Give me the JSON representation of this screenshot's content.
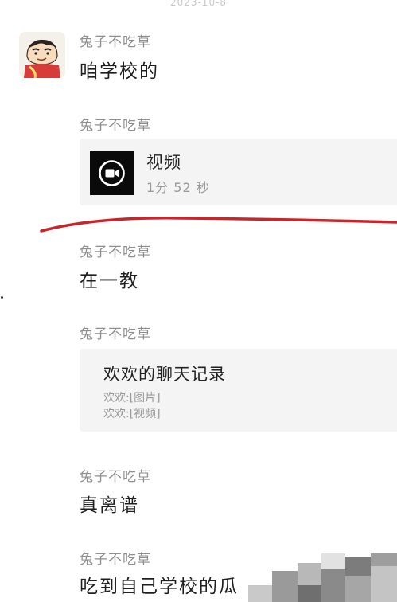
{
  "timestamp": "2023-10-8",
  "messages": [
    {
      "sender": "兔子不吃草",
      "text": "咱学校的"
    },
    {
      "sender": "兔子不吃草",
      "video": {
        "label": "视频",
        "duration": "1分 52 秒"
      }
    },
    {
      "sender": "兔子不吃草",
      "text": "在一教"
    },
    {
      "sender": "兔子不吃草",
      "chat_record": {
        "title": "欢欢的聊天记录",
        "lines": [
          "欢欢:[图片]",
          "欢欢:[视频]"
        ]
      }
    },
    {
      "sender": "兔子不吃草",
      "text": "真离谱"
    },
    {
      "sender": "兔子不吃草",
      "text": "吃到自己学校的瓜"
    }
  ],
  "icons": {
    "video": "video-camera-icon",
    "avatar": "cartoon-avatar"
  },
  "colors": {
    "annotation": "#c8262b",
    "card": "#f4f4f4",
    "sender": "#8f8f8f"
  }
}
